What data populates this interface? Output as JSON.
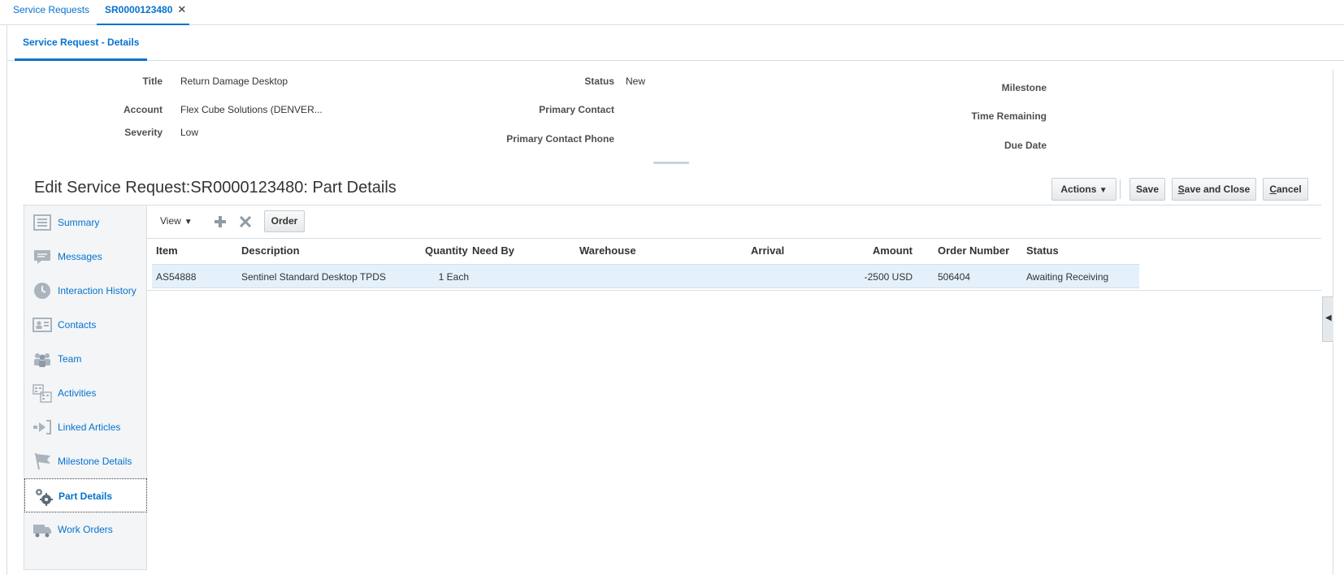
{
  "top_tabs": {
    "service_requests": "Service Requests",
    "current": "SR0000123480",
    "close_glyph": "✕"
  },
  "sub_tab": "Service Request - Details",
  "header": {
    "title_label": "Title",
    "title_value": "Return Damage Desktop",
    "account_label": "Account",
    "account_value": "Flex Cube Solutions (DENVER...",
    "severity_label": "Severity",
    "severity_value": "Low",
    "status_label": "Status",
    "status_value": "New",
    "primary_contact_label": "Primary Contact",
    "primary_contact_phone_label": "Primary Contact Phone",
    "milestone_label": "Milestone",
    "time_remaining_label": "Time Remaining",
    "due_date_label": "Due Date"
  },
  "page_title": "Edit Service Request:SR0000123480: Part Details",
  "buttons": {
    "actions": "Actions",
    "save": "Save",
    "save_and_close_first": "S",
    "save_and_close_rest": "ave and Close",
    "cancel_first": "C",
    "cancel_rest": "ancel"
  },
  "nav": {
    "items": [
      {
        "label": "Summary",
        "icon": "summary-icon"
      },
      {
        "label": "Messages",
        "icon": "messages-icon"
      },
      {
        "label": "Interaction History",
        "icon": "clock-icon"
      },
      {
        "label": "Contacts",
        "icon": "contacts-icon"
      },
      {
        "label": "Team",
        "icon": "team-icon"
      },
      {
        "label": "Activities",
        "icon": "activities-icon"
      },
      {
        "label": "Linked Articles",
        "icon": "linked-articles-icon"
      },
      {
        "label": "Milestone Details",
        "icon": "flag-icon"
      },
      {
        "label": "Part Details",
        "icon": "gears-icon"
      },
      {
        "label": "Work Orders",
        "icon": "truck-icon"
      }
    ],
    "selected": "Part Details"
  },
  "toolbar": {
    "view": "View",
    "order": "Order"
  },
  "table": {
    "columns": [
      "Item",
      "Description",
      "Quantity",
      "Need By",
      "Warehouse",
      "Arrival",
      "Amount",
      "Order Number",
      "Status"
    ],
    "rows": [
      {
        "item": "AS54888",
        "description": "Sentinel Standard Desktop TPDS",
        "quantity": "1 Each",
        "need_by": "",
        "warehouse": "",
        "arrival": "",
        "amount": "-2500 USD",
        "order_number": "506404",
        "status": "Awaiting Receiving"
      }
    ]
  },
  "colors": {
    "link": "#0572ce",
    "selected_row": "#e4f1fb",
    "border": "#d6dfe6"
  }
}
